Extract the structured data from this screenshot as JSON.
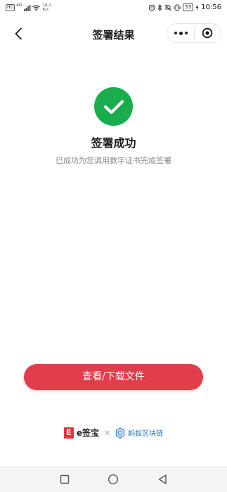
{
  "status_bar": {
    "hd": "HD",
    "network": "4G",
    "speed_value": "18.2",
    "speed_unit": "K/s",
    "battery": "53",
    "time": "10:56"
  },
  "nav": {
    "title": "签署结果"
  },
  "result": {
    "title": "签署成功",
    "description": "已成功为您调用数字证书完成签署",
    "status_color": "#1aad4d"
  },
  "actions": {
    "primary_label": "查看/下载文件",
    "primary_color": "#e23d4b"
  },
  "footer": {
    "esign_logo_char": "E",
    "esign_name": "e签宝",
    "cross": "×",
    "partner_name": "蚂蚁区块链"
  },
  "icons": {
    "back": "chevron-left-icon",
    "more": "more-dots-icon",
    "close": "target-close-icon",
    "success": "check-icon",
    "recent_apps": "square-icon",
    "home": "circle-icon",
    "back_nav": "triangle-back-icon"
  }
}
